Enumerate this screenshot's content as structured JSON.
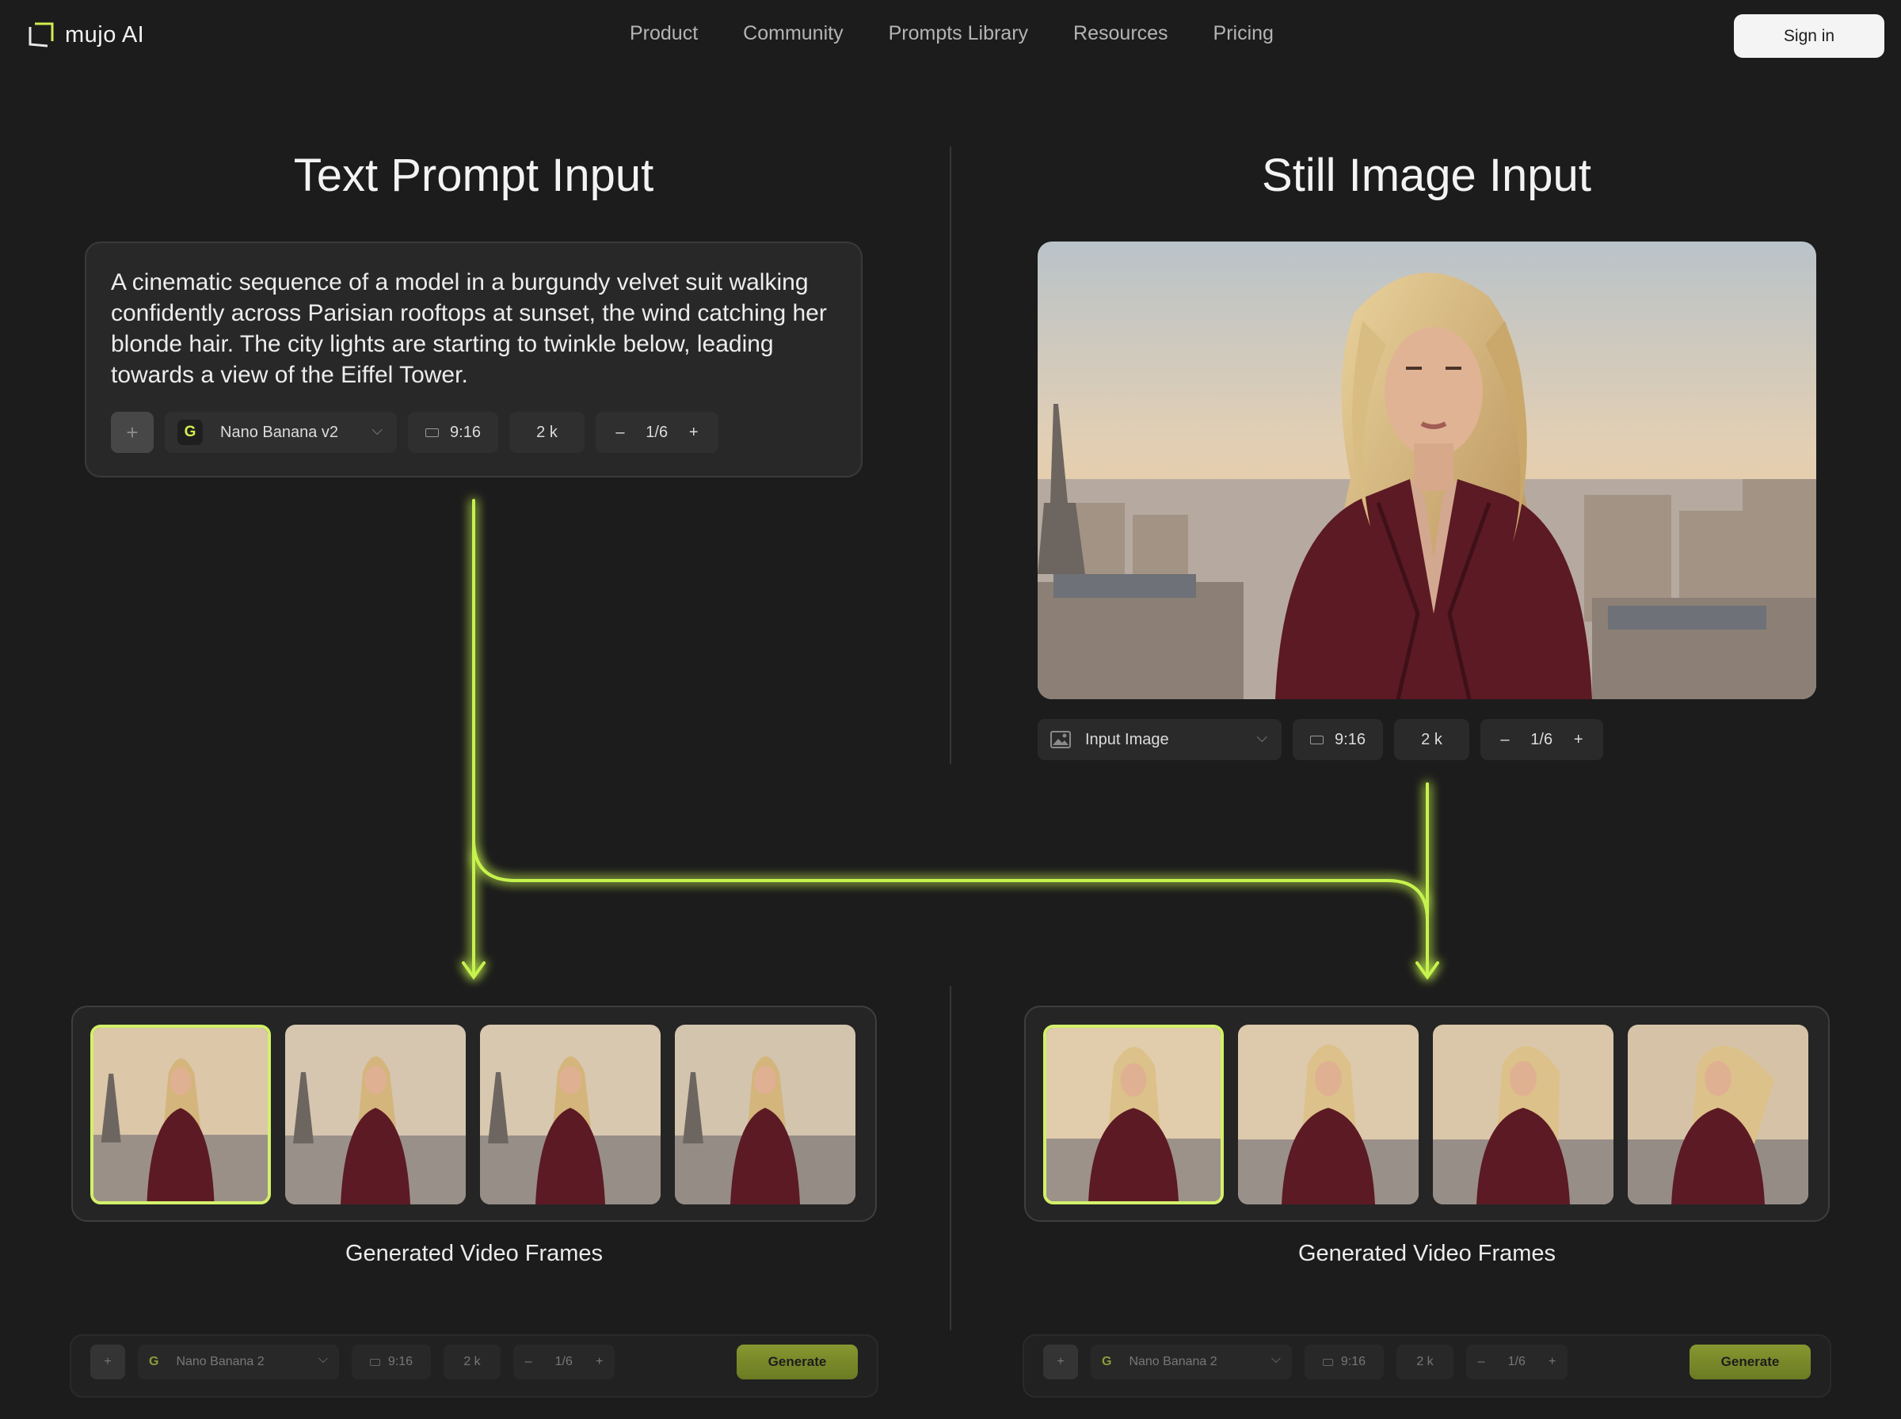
{
  "nav": {
    "brand": "mujo AI",
    "links": [
      "Product",
      "Community",
      "Prompts Library",
      "Resources",
      "Pricing"
    ],
    "signin": "Sign in"
  },
  "left": {
    "title": "Text Prompt Input",
    "prompt": "A cinematic sequence of a model in a burgundy velvet suit walking confidently across Parisian rooftops at sunset, the wind catching her blonde hair. The city lights are starting to twinkle below, leading towards a view of the Eiffel Tower.",
    "controls": {
      "plus": "+",
      "model_badge": "G",
      "model": "Nano Banana v2",
      "chevron": "⌵",
      "ratio": "9:16",
      "resolution": "2 k",
      "minus": "–",
      "count": "1/6",
      "add": "+"
    },
    "frames_label": "Generated Video Frames",
    "bottom": {
      "plus": "+",
      "badge": "G",
      "model": "Nano Banana 2",
      "chevron": "⌵",
      "ratio": "9:16",
      "resolution": "2 k",
      "minus": "–",
      "count": "1/6",
      "add": "+",
      "generate": "Generate"
    }
  },
  "right": {
    "title": "Still Image Input",
    "controls": {
      "input_label": "Input Image",
      "chevron": "⌵",
      "ratio": "9:16",
      "resolution": "2 k",
      "minus": "–",
      "count": "1/6",
      "add": "+"
    },
    "frames_label": "Generated Video Frames",
    "bottom": {
      "plus": "+",
      "badge": "G",
      "model": "Nano Banana 2",
      "chevron": "⌵",
      "ratio": "9:16",
      "resolution": "2 k",
      "minus": "–",
      "count": "1/6",
      "add": "+",
      "generate": "Generate"
    }
  },
  "colors": {
    "accent": "#c6f24e",
    "background": "#1c1c1c",
    "card": "#282828",
    "generate": "#8ea12a",
    "suit": "#5c1a24"
  },
  "icons": [
    "logo-icon",
    "chevron-down-icon",
    "aspect-ratio-icon",
    "image-icon",
    "plus-icon",
    "minus-icon",
    "arrow-down-icon"
  ]
}
